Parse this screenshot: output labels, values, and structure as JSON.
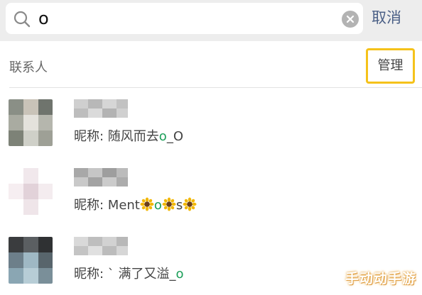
{
  "search": {
    "value": "o"
  },
  "cancel_label": "取消",
  "contacts_section": {
    "title": "联系人",
    "manage_label": "管理"
  },
  "contacts": [
    {
      "nickname_label": "昵称: ",
      "nickname_pre": "随风而去",
      "nickname_match": "o",
      "nickname_post": "_O"
    },
    {
      "nickname_label": "昵称: ",
      "nickname_pre": "Ment",
      "nickname_match_1": "o",
      "nickname_post": "s",
      "nickname_icon": "sunflower-icon"
    },
    {
      "nickname_label": "昵称: ",
      "nickname_pre": "` 满了又溢_",
      "nickname_match": "o"
    }
  ],
  "watermark": "手动动手游",
  "colors": {
    "cancel_text": "#4a5f86",
    "match_highlight": "#1a9e58",
    "manage_outline": "#f5c21a",
    "search_bg": "#ededed"
  }
}
